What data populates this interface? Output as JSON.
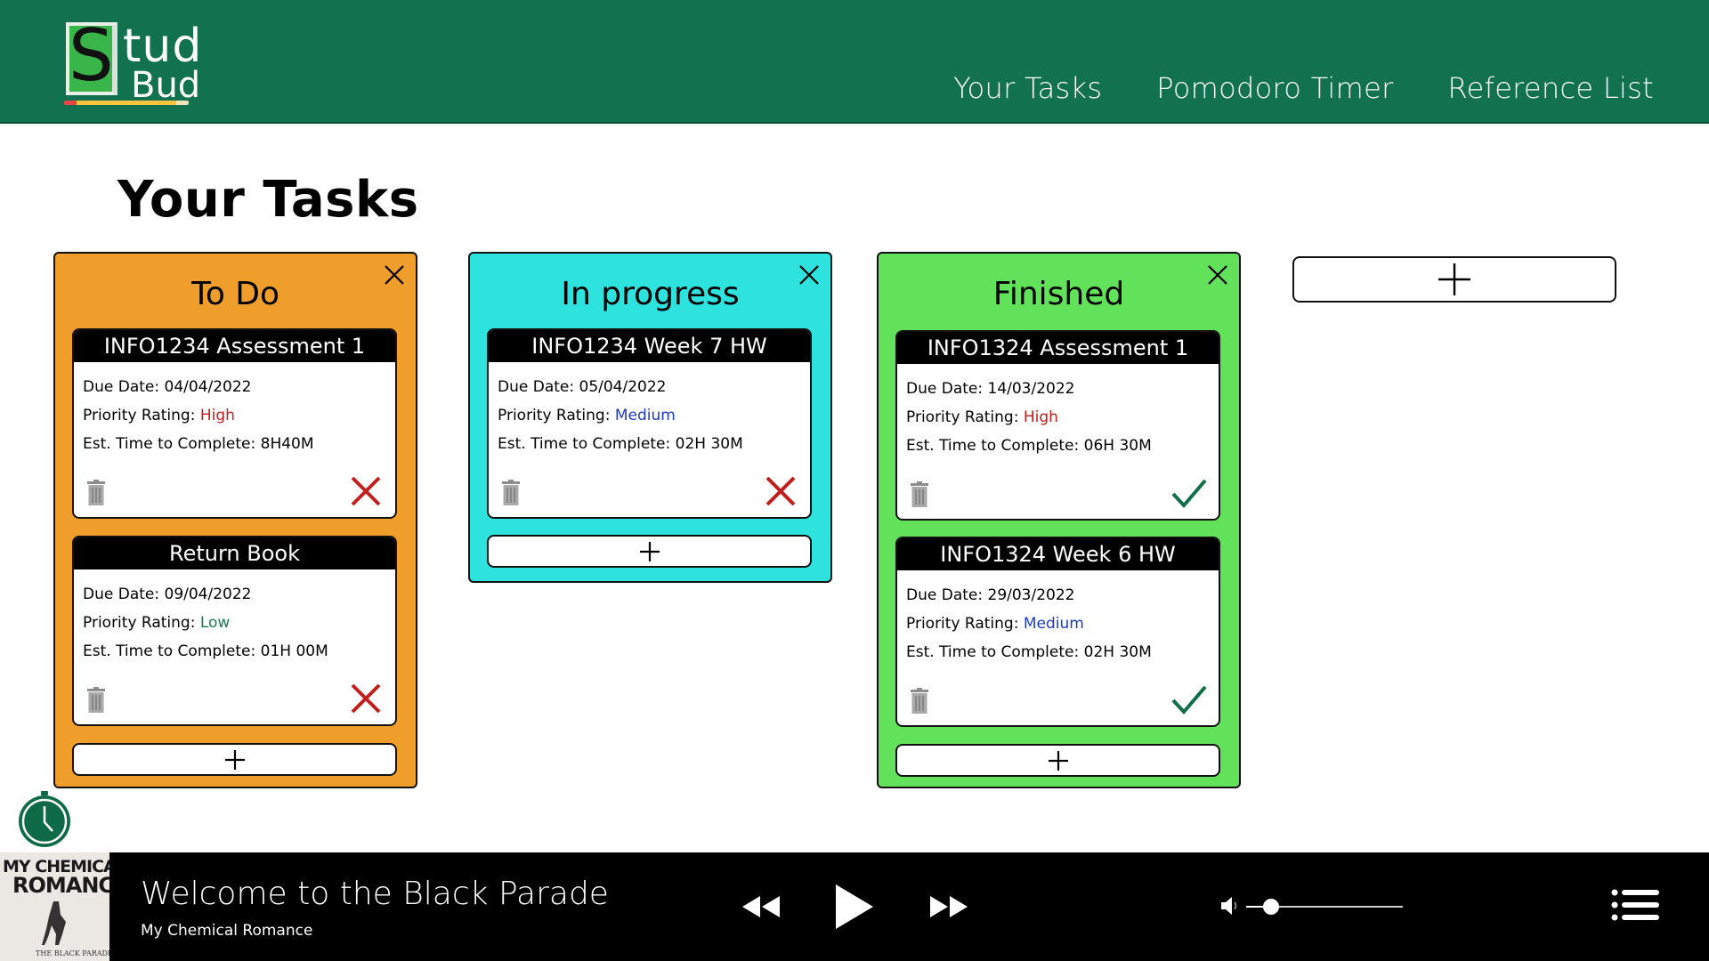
{
  "header": {
    "logo": {
      "letter": "S",
      "line1": "tud",
      "line2": "Bud"
    },
    "nav": [
      {
        "label": "Your Tasks"
      },
      {
        "label": "Pomodoro Timer"
      },
      {
        "label": "Reference List"
      }
    ]
  },
  "page": {
    "title": "Your Tasks"
  },
  "columns": [
    {
      "title": "To Do",
      "color": "#ef9d2b",
      "cards": [
        {
          "title": "INFO1234 Assessment 1",
          "due_label": "Due Date:",
          "due": "04/04/2022",
          "priority_label": "Priority Rating:",
          "priority": "High",
          "time_label": "Est. Time to Complete:",
          "time": "8H40M",
          "status": "incomplete"
        },
        {
          "title": "Return Book",
          "due_label": "Due Date:",
          "due": "09/04/2022",
          "priority_label": "Priority Rating:",
          "priority": "Low",
          "time_label": "Est. Time to Complete:",
          "time": "01H 00M",
          "status": "incomplete"
        }
      ]
    },
    {
      "title": "In progress",
      "color": "#2ee2dd",
      "cards": [
        {
          "title": "INFO1234 Week 7 HW",
          "due_label": "Due Date:",
          "due": "05/04/2022",
          "priority_label": "Priority Rating:",
          "priority": "Medium",
          "time_label": "Est. Time to Complete:",
          "time": "02H 30M",
          "status": "incomplete"
        }
      ]
    },
    {
      "title": "Finished",
      "color": "#62e25a",
      "cards": [
        {
          "title": "INFO1324 Assessment 1",
          "due_label": "Due Date:",
          "due": "14/03/2022",
          "priority_label": "Priority Rating:",
          "priority": "High",
          "time_label": "Est. Time to Complete:",
          "time": "06H 30M",
          "status": "complete"
        },
        {
          "title": "INFO1324 Week 6 HW",
          "due_label": "Due Date:",
          "due": "29/03/2022",
          "priority_label": "Priority Rating:",
          "priority": "Medium",
          "time_label": "Est. Time to Complete:",
          "time": "02H 30M",
          "status": "complete"
        }
      ]
    }
  ],
  "icons": {
    "column_close": "close-icon",
    "trash": "trash-icon",
    "incomplete": "cross-icon",
    "complete": "check-icon",
    "add": "plus-icon",
    "timer": "clock-icon"
  },
  "colors": {
    "brand_green": "#12714f",
    "priority_high": "#c0201d",
    "priority_medium": "#1f3bbd",
    "priority_low": "#1d7b4f",
    "cross": "#c0201d",
    "check": "#0f7048"
  },
  "player": {
    "album_art_text": "MY CHEMICAL ROMANCE",
    "song_title": "Welcome to the Black Parade",
    "artist": "My Chemical Romance",
    "volume": 0.16,
    "controls": [
      "rewind-icon",
      "play-icon",
      "fast-forward-icon",
      "volume-icon",
      "queue-icon"
    ]
  }
}
